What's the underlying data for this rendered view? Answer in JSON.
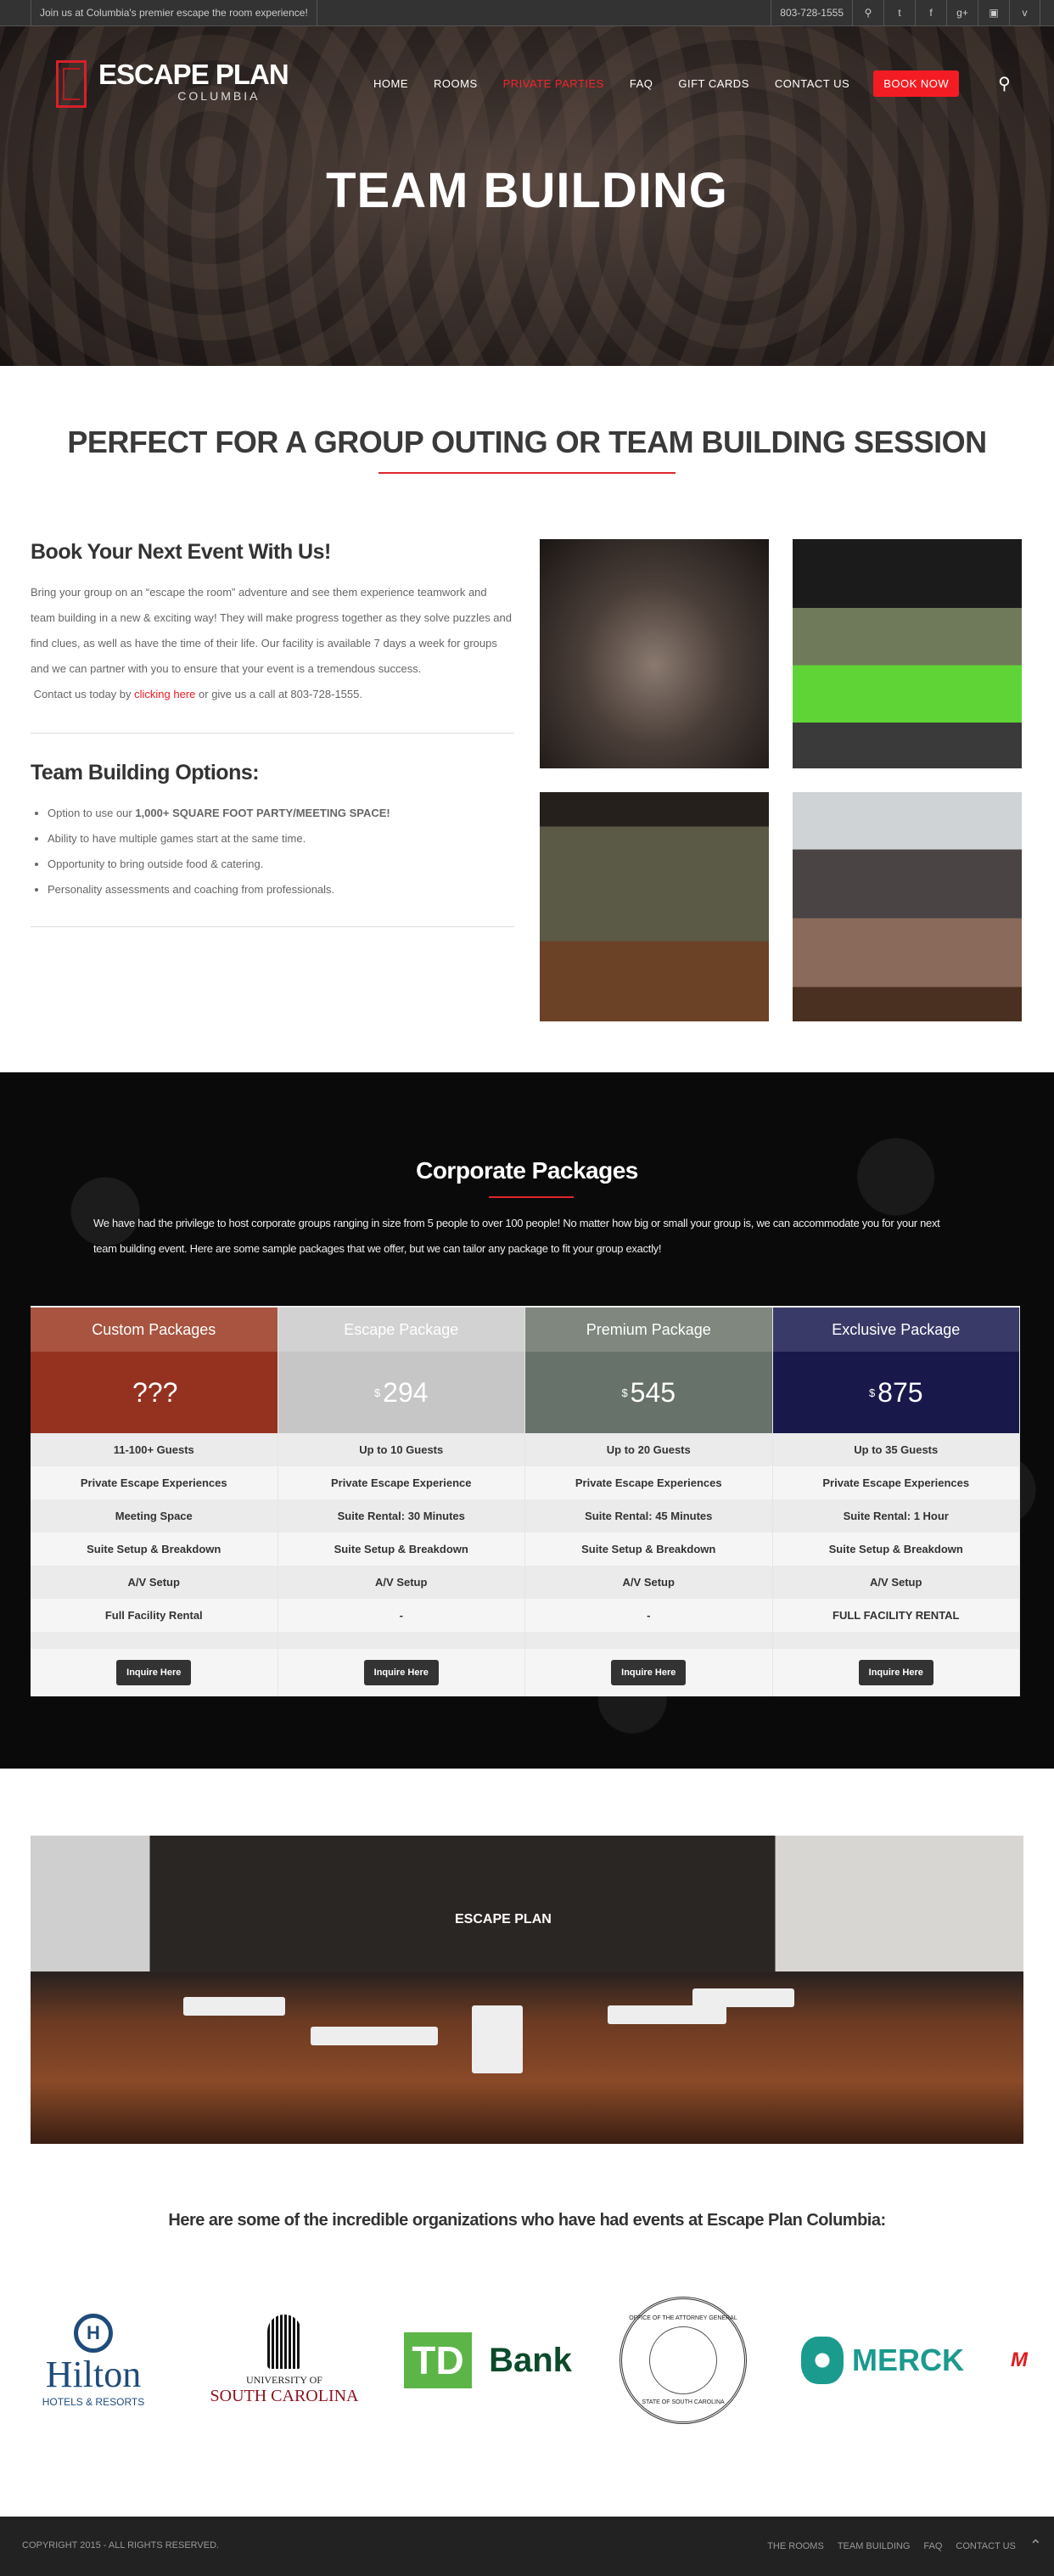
{
  "topbar": {
    "message": "Join us at Columbia's premier escape the room experience!",
    "phone": "803-728-1555",
    "icons": [
      "search-icon",
      "twitter-icon",
      "facebook-icon",
      "google-plus-icon",
      "instagram-icon",
      "vimeo-icon"
    ]
  },
  "header": {
    "logo_text": "ESCAPE PLAN",
    "logo_sub": "COLUMBIA",
    "nav": [
      "HOME",
      "ROOMS",
      "PRIVATE PARTIES",
      "FAQ",
      "GIFT CARDS",
      "CONTACT US"
    ],
    "active": "PRIVATE PARTIES",
    "book_label": "BOOK NOW"
  },
  "hero": {
    "title": "TEAM BUILDING"
  },
  "intro": {
    "heading": "PERFECT FOR A GROUP OUTING OR TEAM BUILDING SESSION"
  },
  "book": {
    "title": "Book Your Next Event With Us!",
    "body": "Bring your group on an “escape the room” adventure and see them experience teamwork and team building in a new & exciting way!  They will make progress together as they solve puzzles and find clues, as well as have the time of their life.  Our facility is available 7 days a week for groups and we can partner with you to ensure that your event is a tremendous success.",
    "contact_pre": "Contact us today by ",
    "contact_link": "clicking here",
    "contact_post": " or give us a call at 803-728-1555."
  },
  "options": {
    "title": "Team Building Options:",
    "item0_pre": "Option to use our ",
    "item0_bold": "1,000+ SQUARE FOOT PARTY/MEETING SPACE!",
    "items": [
      "Ability to have multiple games start at the same time.",
      "Opportunity to bring outside food & catering.",
      "Personality assessments and coaching from professionals."
    ]
  },
  "corporate": {
    "title": "Corporate Packages",
    "body": "We have had the privilege to host corporate groups ranging in size from 5 people to over 100 people!  No matter how big or small your group is, we can accommodate you for your next team building event.  Here are some sample packages that we offer, but we can tailor any package to fit your group exactly!",
    "packages": [
      {
        "name": "Custom Packages",
        "currency": "",
        "price": "???",
        "head_color": "#a85440",
        "price_color": "#95321f",
        "features": [
          "11-100+ Guests",
          "Private Escape Experiences",
          "Meeting Space",
          "Suite Setup & Breakdown",
          "A/V Setup",
          "Full Facility Rental"
        ],
        "button": "Inquire Here"
      },
      {
        "name": "Escape Package",
        "currency": "$",
        "price": "294",
        "head_color": "#d2d2d2",
        "price_color": "#c6c6c6",
        "features": [
          "Up to 10 Guests",
          "Private Escape Experience",
          "Suite Rental: 30 Minutes",
          "Suite Setup & Breakdown",
          "A/V Setup",
          "-"
        ],
        "button": "Inquire Here"
      },
      {
        "name": "Premium Package",
        "currency": "$",
        "price": "545",
        "head_color": "#7f877f",
        "price_color": "#67726a",
        "features": [
          "Up to 20 Guests",
          "Private Escape Experiences",
          "Suite Rental: 45 Minutes",
          "Suite Setup & Breakdown",
          "A/V Setup",
          "-"
        ],
        "button": "Inquire Here"
      },
      {
        "name": "Exclusive Package",
        "currency": "$",
        "price": "875",
        "head_color": "#3a3a68",
        "price_color": "#18194a",
        "features": [
          "Up to 35 Guests",
          "Private Escape Experiences",
          "Suite Rental: 1 Hour",
          "Suite Setup & Breakdown",
          "A/V Setup",
          "FULL FACILITY RENTAL"
        ],
        "button": "Inquire Here"
      }
    ]
  },
  "panorama": {
    "sign": "ESCAPE PLAN"
  },
  "orgs": {
    "heading": "Here are some of the incredible organizations who have had events at Escape Plan Columbia:",
    "logos": [
      {
        "name": "Hilton",
        "sub": "HOTELS & RESORTS"
      },
      {
        "name": "SOUTH CAROLINA",
        "sub": "UNIVERSITY OF"
      },
      {
        "name": "Bank",
        "sub": "TD"
      },
      {
        "name": "OFFICE OF THE ATTORNEY GENERAL",
        "sub": "STATE OF SOUTH CAROLINA"
      },
      {
        "name": "MERCK",
        "sub": ""
      },
      {
        "name": "M",
        "sub": ""
      }
    ]
  },
  "footer": {
    "copyright": "COPYRIGHT 2015 - ALL RIGHTS RESERVED.",
    "links": [
      "THE ROOMS",
      "TEAM BUILDING",
      "FAQ",
      "CONTACT US"
    ]
  }
}
